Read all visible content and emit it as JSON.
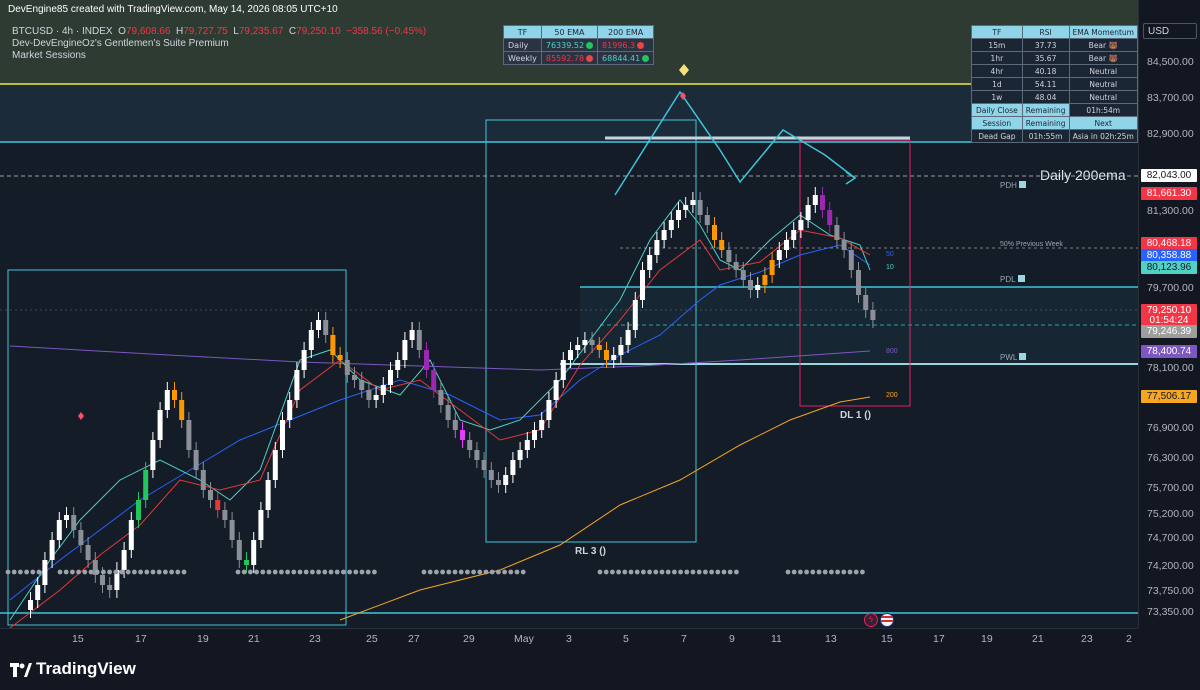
{
  "header": {
    "attribution": "DevEngine85 created with TradingView.com, May 14, 2026 08:05 UTC+10"
  },
  "legend": {
    "symbol": "BTCUSD · 4h · INDEX",
    "o_label": "O",
    "o_value": "79,608.66",
    "h_label": "H",
    "h_value": "79,727.75",
    "l_label": "L",
    "l_value": "79,235.67",
    "c_label": "C",
    "c_value": "79,250.10",
    "change": "−358.56 (−0.45%)",
    "indicator1": "Dev-DevEngineOz's Gentlemen's Suite Premium",
    "indicator2": "Market Sessions"
  },
  "ema_table": {
    "headers": [
      "TF",
      "50 EMA",
      "200 EMA"
    ],
    "rows": [
      {
        "tf": "Daily",
        "ema50": "76339.52",
        "ema50_dot": "#22c55e",
        "ema200": "81996.3",
        "ema200_dot": "#ef4444"
      },
      {
        "tf": "Weekly",
        "ema50": "85592.78",
        "ema50_dot": "#ef4444",
        "ema200": "68844.41",
        "ema200_dot": "#22c55e"
      }
    ]
  },
  "rsi_table": {
    "headers": [
      "TF",
      "RSI",
      "EMA Momentum"
    ],
    "rows": [
      {
        "tf": "15m",
        "rsi": "37.73",
        "mom": "Bear 🐻",
        "bear": true
      },
      {
        "tf": "1hr",
        "rsi": "35.67",
        "mom": "Bear 🐻",
        "bear": true
      },
      {
        "tf": "4hr",
        "rsi": "40.18",
        "mom": "Neutral",
        "bear": false
      },
      {
        "tf": "1d",
        "rsi": "54.11",
        "mom": "Neutral",
        "bear": false
      },
      {
        "tf": "1w",
        "rsi": "48.04",
        "mom": "Neutral",
        "bear": false
      }
    ],
    "daily_close_label": "Daily Close",
    "remaining_label": "Remaining",
    "daily_close_remaining": "01h:54m",
    "session_label": "Session",
    "session_remaining_label": "Remaining",
    "next_label": "Next",
    "session": "Dead Gap",
    "session_remaining": "01h:55m",
    "next_session": "Asia in 02h:25m"
  },
  "annotations": {
    "daily_200ema": "Daily 200ema",
    "pdh": "PDH",
    "pdl": "PDL",
    "pwl": "PWL",
    "prev_week_50": "50% Previous Week",
    "ema50": "50",
    "ema10": "10",
    "ema800": "800",
    "ema200": "200",
    "dl1": "DL 1 ()",
    "rl3": "RL 3 ()"
  },
  "price_axis": {
    "currency": "USD",
    "ticks": [
      "84,500.00",
      "83,700.00",
      "82,900.00",
      "81,300.00",
      "79,700.00",
      "78,100.00",
      "76,900.00",
      "76,300.00",
      "75,700.00",
      "75,200.00",
      "74,700.00",
      "74,200.00",
      "73,750.00",
      "73,350.00"
    ],
    "tags": [
      {
        "label": "82,043.00",
        "color": "#ffffff",
        "text": "#131722"
      },
      {
        "label": "81,661.30",
        "color": "#f23645",
        "text": "#ffffff"
      },
      {
        "label": "80,468.18",
        "color": "#f23645",
        "text": "#ffffff"
      },
      {
        "label": "80,358.88",
        "color": "#2962ff",
        "text": "#ffffff"
      },
      {
        "label": "80,123.96",
        "color": "#4fd1c5",
        "text": "#131722"
      },
      {
        "label": "79,250.10",
        "color": "#f23645",
        "text": "#ffffff"
      },
      {
        "label": "01:54:24",
        "color": "#f23645",
        "text": "#ffffff"
      },
      {
        "label": "79,246.39",
        "color": "#9e9e9e",
        "text": "#ffffff"
      },
      {
        "label": "78,400.74",
        "color": "#7e57c2",
        "text": "#ffffff"
      },
      {
        "label": "77,506.17",
        "color": "#f5a623",
        "text": "#131722"
      }
    ]
  },
  "time_axis": {
    "ticks": [
      "15",
      "17",
      "19",
      "21",
      "23",
      "25",
      "27",
      "29",
      "May",
      "3",
      "5",
      "7",
      "9",
      "11",
      "13",
      "15",
      "17",
      "19",
      "21",
      "23",
      "2"
    ]
  },
  "footer": {
    "brand": "TradingView"
  },
  "colors": {
    "bull": "#ffffff",
    "bear": "#9e9e9e",
    "accent_cyan": "#40c4d8",
    "ema_red": "#e53935",
    "ema_blue": "#2962ff",
    "ema_teal": "#4fd1c5",
    "ema_purple": "#7e57c2",
    "ema_gold": "#f5a623"
  }
}
